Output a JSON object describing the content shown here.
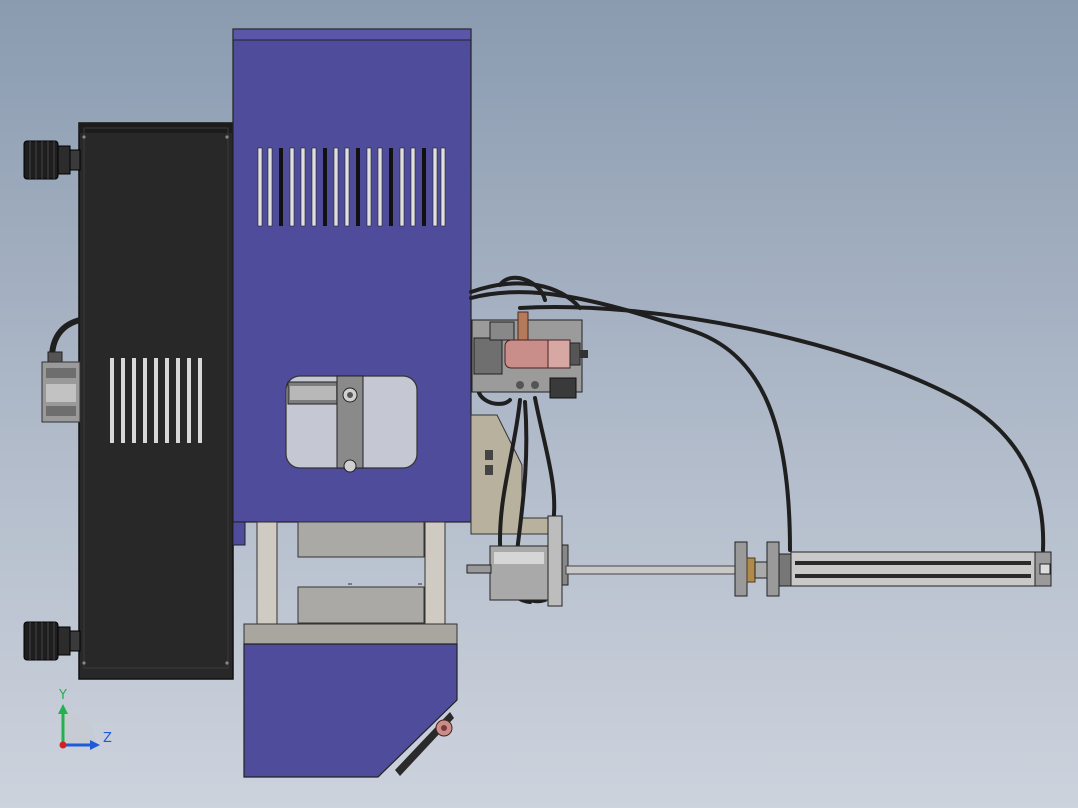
{
  "viewport": {
    "background_top": "#8a9bb0",
    "background_bottom": "#cdd3dd"
  },
  "colors": {
    "enclosure_blue": "#4f4c9c",
    "enclosure_blue_dark": "#3e3b84",
    "dark_panel": "#2a2a2a",
    "cable": "#1f1f1f",
    "steel": "#c8c8c8",
    "frame_tan": "#b7b19e",
    "copper": "#c98e8a"
  },
  "triad": {
    "y_label": "Y",
    "z_label": "Z",
    "y_color": "#22b14c",
    "z_color": "#1e5bd6",
    "x_color": "#d42020"
  }
}
